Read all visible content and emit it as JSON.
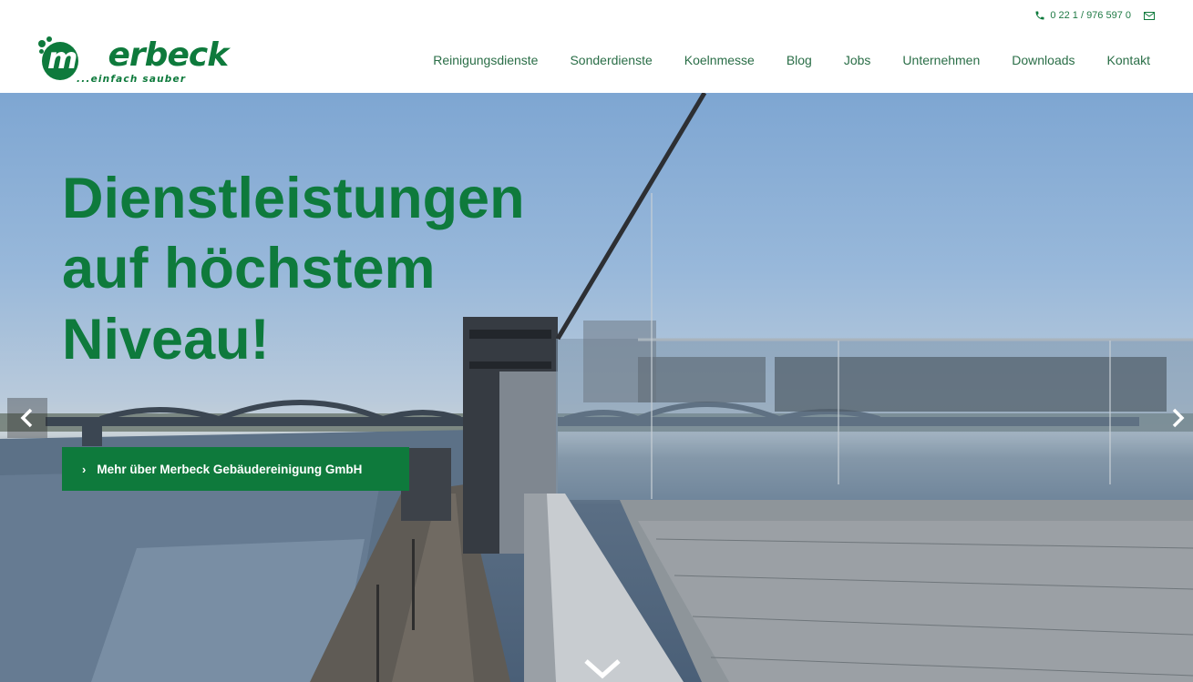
{
  "topbar": {
    "phone": "0 22 1 / 976 597 0"
  },
  "logo": {
    "name": "merbeck",
    "tagline": "...einfach sauber"
  },
  "nav": {
    "items": [
      "Reinigungsdienste",
      "Sonderdienste",
      "Koelnmesse",
      "Blog",
      "Jobs",
      "Unternehmen",
      "Downloads",
      "Kontakt"
    ]
  },
  "hero": {
    "headline_lines": [
      "Dienstleistungen",
      "auf höchstem",
      "Niveau!"
    ],
    "cta_label": "Mehr über Merbeck Gebäudereinigung GmbH"
  },
  "colors": {
    "brand_green": "#0e7a3c",
    "nav_text": "#2a6e47"
  },
  "icons": {
    "phone": "phone-icon",
    "mail": "mail-icon",
    "prev": "chevron-left-icon",
    "next": "chevron-right-icon",
    "scroll": "chevron-down-icon",
    "cta": "chevron-right-icon"
  }
}
